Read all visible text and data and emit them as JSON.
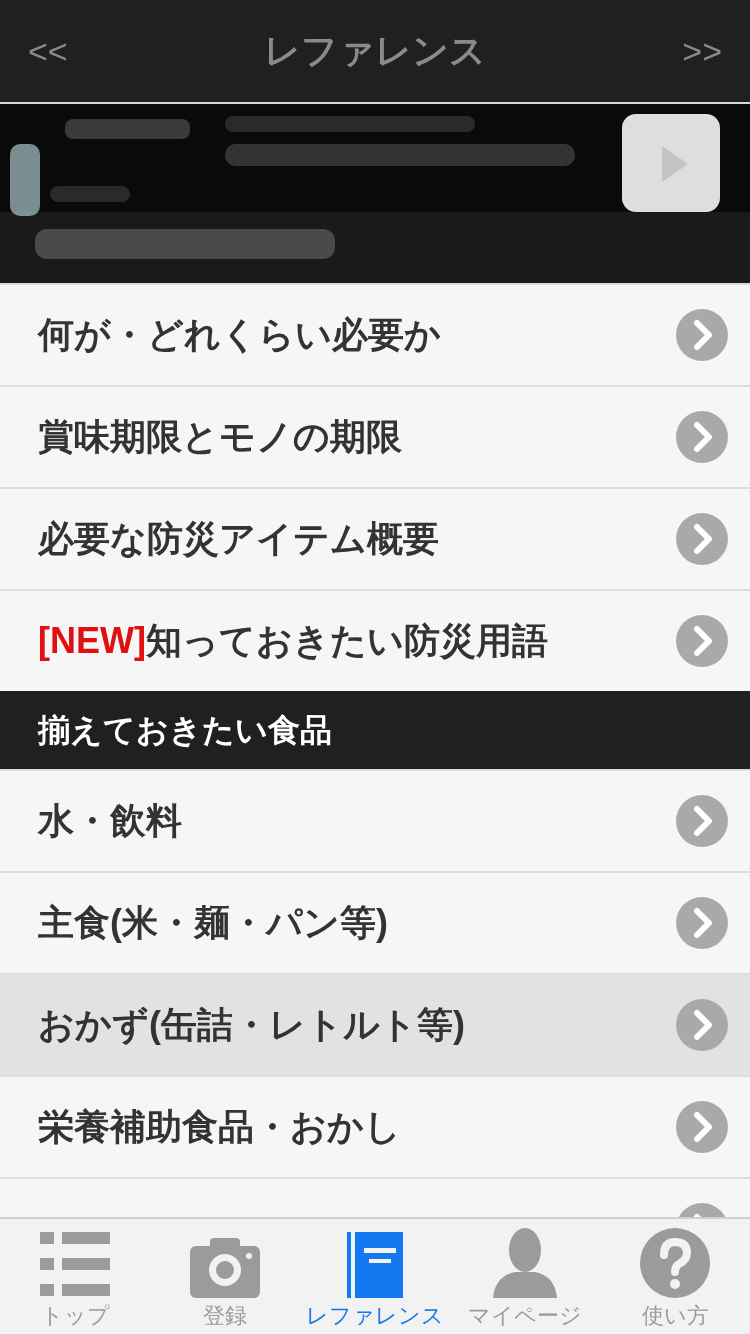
{
  "header": {
    "back": "<<",
    "title": "レファレンス",
    "forward": ">>"
  },
  "sections": [
    {
      "items": [
        {
          "label": "何が・どれくらい必要か",
          "selected": false
        },
        {
          "label": "賞味期限とモノの期限",
          "selected": false
        },
        {
          "label": "必要な防災アイテム概要",
          "selected": false
        },
        {
          "badge": "[NEW]",
          "label": "知っておきたい防災用語",
          "selected": false
        }
      ]
    },
    {
      "title": "揃えておきたい食品",
      "items": [
        {
          "label": "水・飲料",
          "selected": false
        },
        {
          "label": "主食(米・麺・パン等)",
          "selected": false
        },
        {
          "label": "おかず(缶詰・レトルト等)",
          "selected": true
        },
        {
          "label": "栄養補助食品・おかし",
          "selected": false
        },
        {
          "selected": false
        }
      ]
    }
  ],
  "tab_bar": [
    {
      "kind": "list",
      "label": "トップ",
      "selected": false
    },
    {
      "kind": "camera",
      "label": "登録",
      "selected": false
    },
    {
      "kind": "book",
      "label": "レファレンス",
      "selected": true
    },
    {
      "kind": "person",
      "label": "マイページ",
      "selected": false
    },
    {
      "kind": "help",
      "label": "使い方",
      "selected": false
    }
  ]
}
